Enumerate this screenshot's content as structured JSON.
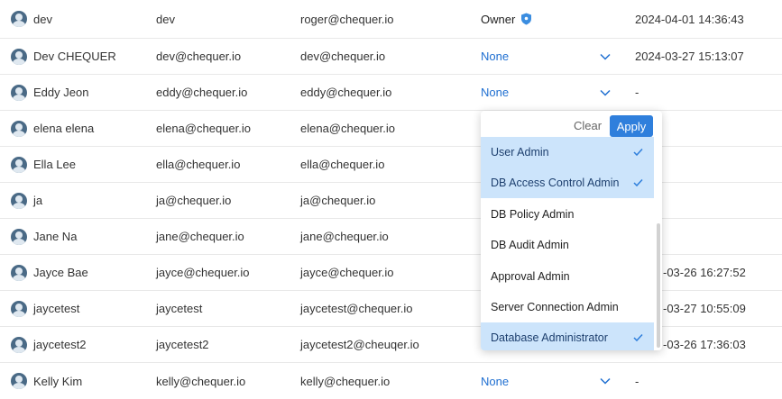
{
  "users": [
    {
      "name": "dev",
      "username": "dev",
      "email": "roger@chequer.io",
      "role": "Owner",
      "role_type": "owner",
      "date": "2024-04-01 14:36:43"
    },
    {
      "name": "Dev CHEQUER",
      "username": "dev@chequer.io",
      "email": "dev@chequer.io",
      "role": "None",
      "role_type": "select",
      "date": "2024-03-27 15:13:07"
    },
    {
      "name": "Eddy Jeon",
      "username": "eddy@chequer.io",
      "email": "eddy@chequer.io",
      "role": "None",
      "role_type": "select",
      "date": "-"
    },
    {
      "name": "elena elena",
      "username": "elena@chequer.io",
      "email": "elena@chequer.io",
      "role": "",
      "role_type": "hidden",
      "date": ""
    },
    {
      "name": "Ella Lee",
      "username": "ella@chequer.io",
      "email": "ella@chequer.io",
      "role": "",
      "role_type": "hidden",
      "date": ""
    },
    {
      "name": "ja",
      "username": "ja@chequer.io",
      "email": "ja@chequer.io",
      "role": "",
      "role_type": "hidden",
      "date": ""
    },
    {
      "name": "Jane Na",
      "username": "jane@chequer.io",
      "email": "jane@chequer.io",
      "role": "",
      "role_type": "hidden",
      "date": ""
    },
    {
      "name": "Jayce Bae",
      "username": "jayce@chequer.io",
      "email": "jayce@chequer.io",
      "role": "",
      "role_type": "hidden",
      "date": "-03-26 16:27:52"
    },
    {
      "name": "jaycetest",
      "username": "jaycetest",
      "email": "jaycetest@chequer.io",
      "role": "",
      "role_type": "hidden",
      "date": "-03-27 10:55:09"
    },
    {
      "name": "jaycetest2",
      "username": "jaycetest2",
      "email": "jaycetest2@cheuqer.io",
      "role": "",
      "role_type": "hidden",
      "date": "-03-26 17:36:03"
    },
    {
      "name": "Kelly Kim",
      "username": "kelly@chequer.io",
      "email": "kelly@chequer.io",
      "role": "None",
      "role_type": "select",
      "date": "-"
    }
  ],
  "dropdown": {
    "clear_label": "Clear",
    "apply_label": "Apply",
    "options": [
      {
        "label": "User Admin",
        "selected": true
      },
      {
        "label": "DB Access Control Admin",
        "selected": true
      },
      {
        "label": "DB Policy Admin",
        "selected": false
      },
      {
        "label": "DB Audit Admin",
        "selected": false
      },
      {
        "label": "Approval Admin",
        "selected": false
      },
      {
        "label": "Server Connection Admin",
        "selected": false
      },
      {
        "label": "Database Administrator",
        "selected": true
      }
    ]
  },
  "colors": {
    "link": "#1f6fd1",
    "apply_button": "#2f7fdc",
    "selected_option": "#cce4fb",
    "owner_shield": "#3b8de0"
  }
}
